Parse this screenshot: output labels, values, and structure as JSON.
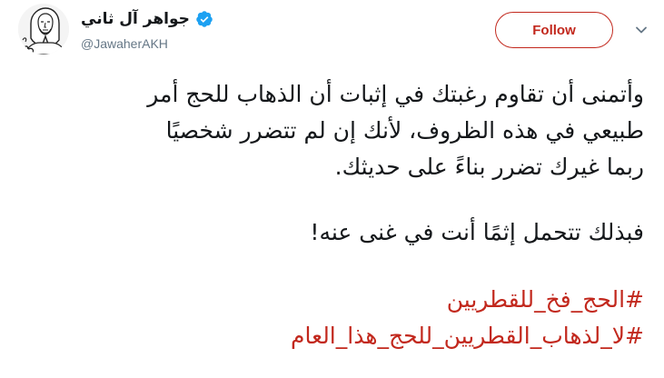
{
  "author": {
    "display_name": "جواهر آل ثاني",
    "handle": "@JawaherAKH",
    "avatar_icon": "portrait-sketch-icon",
    "verified_icon": "verified-badge-icon"
  },
  "actions": {
    "follow_label": "Follow",
    "menu_icon": "chevron-down-icon"
  },
  "tweet": {
    "paragraph1": [
      "وأتمنى أن تقاوم رغبتك في إثبات أن الذهاب للحج أمر",
      "طبيعي في هذه الظروف، لأنك إن لم تتضرر شخصيًا",
      "ربما غيرك تضرر بناءً على حديثك."
    ],
    "paragraph2": "فبذلك تتحمل إثمًا أنت في غنى عنه!",
    "hashtags": [
      "#الحج_فخ_للقطريين",
      "#لا_لذهاب_القطريين_للحج_هذا_العام"
    ]
  },
  "colors": {
    "accent": "#c2281d",
    "verified": "#1da1f2",
    "text": "#14171a",
    "muted": "#657786"
  }
}
